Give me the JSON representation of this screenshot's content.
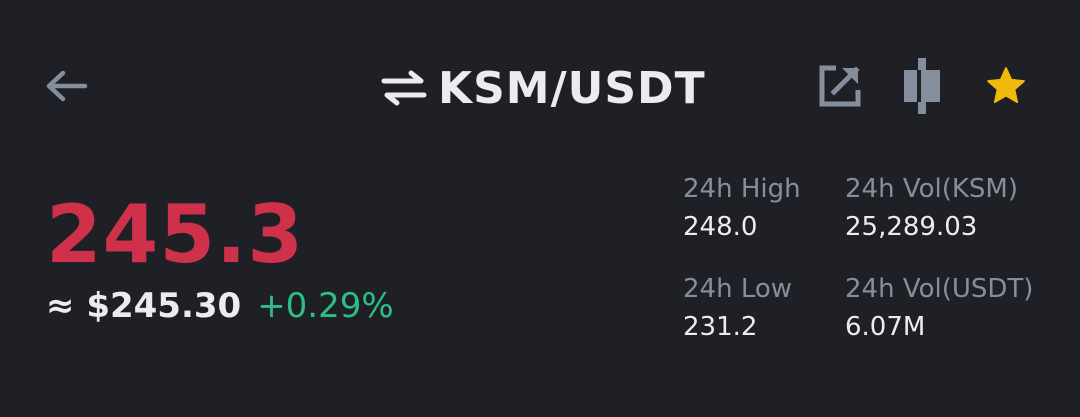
{
  "header": {
    "back_icon": "arrow-left-icon",
    "swap_icon": "swap-arrows-icon",
    "pair": "KSM/USDT",
    "share_icon": "share-external-icon",
    "depth_icon": "depth-chart-icon",
    "favorite_icon": "star-icon"
  },
  "price": {
    "last": "245.3",
    "fiat": "≈ $245.30",
    "change": "+0.29%"
  },
  "stats": {
    "high_label": "24h High",
    "high_value": "248.0",
    "vol_base_label": "24h Vol(KSM)",
    "vol_base_value": "25,289.03",
    "low_label": "24h Low",
    "low_value": "231.2",
    "vol_quote_label": "24h Vol(USDT)",
    "vol_quote_value": "6.07M"
  },
  "colors": {
    "background": "#1e2026",
    "down_red": "#cf304a",
    "up_green": "#2ebd85",
    "muted": "#848e9c",
    "star_gold": "#f0b90b"
  }
}
